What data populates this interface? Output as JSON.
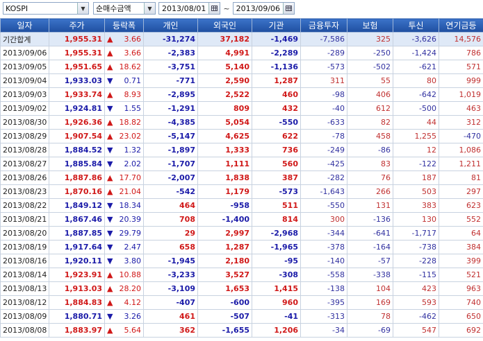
{
  "toolbar": {
    "market": "KOSPI",
    "metric": "순매수금액",
    "start_date": "2013/08/01",
    "separator": "~",
    "end_date": "2013/09/06"
  },
  "columns": [
    "일자",
    "주가",
    "등락폭",
    "개인",
    "외국인",
    "기관",
    "금융투자",
    "보험",
    "투신",
    "연기금등"
  ],
  "summary": {
    "date": "기간합계",
    "price": "1,955.31",
    "dir": "up",
    "change": "3.66",
    "individual": "-31,274",
    "foreign": "37,182",
    "institution": "-1,469",
    "fin_invest": "-7,586",
    "insurance": "325",
    "trust": "-3,626",
    "pension": "14,576"
  },
  "rows": [
    {
      "date": "2013/09/06",
      "price": "1,955.31",
      "dir": "up",
      "change": "3.66",
      "individual": "-2,383",
      "foreign": "4,991",
      "institution": "-2,289",
      "fin_invest": "-289",
      "insurance": "-250",
      "trust": "-1,424",
      "pension": "786"
    },
    {
      "date": "2013/09/05",
      "price": "1,951.65",
      "dir": "up",
      "change": "18.62",
      "individual": "-3,751",
      "foreign": "5,140",
      "institution": "-1,136",
      "fin_invest": "-573",
      "insurance": "-502",
      "trust": "-621",
      "pension": "571"
    },
    {
      "date": "2013/09/04",
      "price": "1,933.03",
      "dir": "down",
      "change": "0.71",
      "individual": "-771",
      "foreign": "2,590",
      "institution": "1,287",
      "fin_invest": "311",
      "insurance": "55",
      "trust": "80",
      "pension": "999"
    },
    {
      "date": "2013/09/03",
      "price": "1,933.74",
      "dir": "up",
      "change": "8.93",
      "individual": "-2,895",
      "foreign": "2,522",
      "institution": "460",
      "fin_invest": "-98",
      "insurance": "406",
      "trust": "-642",
      "pension": "1,019"
    },
    {
      "date": "2013/09/02",
      "price": "1,924.81",
      "dir": "down",
      "change": "1.55",
      "individual": "-1,291",
      "foreign": "809",
      "institution": "432",
      "fin_invest": "-40",
      "insurance": "612",
      "trust": "-500",
      "pension": "463"
    },
    {
      "date": "2013/08/30",
      "price": "1,926.36",
      "dir": "up",
      "change": "18.82",
      "individual": "-4,385",
      "foreign": "5,054",
      "institution": "-550",
      "fin_invest": "-633",
      "insurance": "82",
      "trust": "44",
      "pension": "312"
    },
    {
      "date": "2013/08/29",
      "price": "1,907.54",
      "dir": "up",
      "change": "23.02",
      "individual": "-5,147",
      "foreign": "4,625",
      "institution": "622",
      "fin_invest": "-78",
      "insurance": "458",
      "trust": "1,255",
      "pension": "-470"
    },
    {
      "date": "2013/08/28",
      "price": "1,884.52",
      "dir": "down",
      "change": "1.32",
      "individual": "-1,897",
      "foreign": "1,333",
      "institution": "736",
      "fin_invest": "-249",
      "insurance": "-86",
      "trust": "12",
      "pension": "1,086"
    },
    {
      "date": "2013/08/27",
      "price": "1,885.84",
      "dir": "down",
      "change": "2.02",
      "individual": "-1,707",
      "foreign": "1,111",
      "institution": "560",
      "fin_invest": "-425",
      "insurance": "83",
      "trust": "-122",
      "pension": "1,211"
    },
    {
      "date": "2013/08/26",
      "price": "1,887.86",
      "dir": "up",
      "change": "17.70",
      "individual": "-2,007",
      "foreign": "1,838",
      "institution": "387",
      "fin_invest": "-282",
      "insurance": "76",
      "trust": "187",
      "pension": "81"
    },
    {
      "date": "2013/08/23",
      "price": "1,870.16",
      "dir": "up",
      "change": "21.04",
      "individual": "-542",
      "foreign": "1,179",
      "institution": "-573",
      "fin_invest": "-1,643",
      "insurance": "266",
      "trust": "503",
      "pension": "297"
    },
    {
      "date": "2013/08/22",
      "price": "1,849.12",
      "dir": "down",
      "change": "18.34",
      "individual": "464",
      "foreign": "-958",
      "institution": "511",
      "fin_invest": "-550",
      "insurance": "131",
      "trust": "383",
      "pension": "623"
    },
    {
      "date": "2013/08/21",
      "price": "1,867.46",
      "dir": "down",
      "change": "20.39",
      "individual": "708",
      "foreign": "-1,400",
      "institution": "814",
      "fin_invest": "300",
      "insurance": "-136",
      "trust": "130",
      "pension": "552"
    },
    {
      "date": "2013/08/20",
      "price": "1,887.85",
      "dir": "down",
      "change": "29.79",
      "individual": "29",
      "foreign": "2,997",
      "institution": "-2,968",
      "fin_invest": "-344",
      "insurance": "-641",
      "trust": "-1,717",
      "pension": "64"
    },
    {
      "date": "2013/08/19",
      "price": "1,917.64",
      "dir": "down",
      "change": "2.47",
      "individual": "658",
      "foreign": "1,287",
      "institution": "-1,965",
      "fin_invest": "-378",
      "insurance": "-164",
      "trust": "-738",
      "pension": "384"
    },
    {
      "date": "2013/08/16",
      "price": "1,920.11",
      "dir": "down",
      "change": "3.80",
      "individual": "-1,945",
      "foreign": "2,180",
      "institution": "-95",
      "fin_invest": "-140",
      "insurance": "-57",
      "trust": "-228",
      "pension": "399"
    },
    {
      "date": "2013/08/14",
      "price": "1,923.91",
      "dir": "up",
      "change": "10.88",
      "individual": "-3,233",
      "foreign": "3,527",
      "institution": "-308",
      "fin_invest": "-558",
      "insurance": "-338",
      "trust": "-115",
      "pension": "521"
    },
    {
      "date": "2013/08/13",
      "price": "1,913.03",
      "dir": "up",
      "change": "28.20",
      "individual": "-3,109",
      "foreign": "1,653",
      "institution": "1,415",
      "fin_invest": "-138",
      "insurance": "104",
      "trust": "423",
      "pension": "963"
    },
    {
      "date": "2013/08/12",
      "price": "1,884.83",
      "dir": "up",
      "change": "4.12",
      "individual": "-407",
      "foreign": "-600",
      "institution": "960",
      "fin_invest": "-395",
      "insurance": "169",
      "trust": "593",
      "pension": "740"
    },
    {
      "date": "2013/08/09",
      "price": "1,880.71",
      "dir": "down",
      "change": "3.26",
      "individual": "461",
      "foreign": "-507",
      "institution": "-41",
      "fin_invest": "-313",
      "insurance": "78",
      "trust": "-462",
      "pension": "650"
    },
    {
      "date": "2013/08/08",
      "price": "1,883.97",
      "dir": "up",
      "change": "5.64",
      "individual": "362",
      "foreign": "-1,655",
      "institution": "1,206",
      "fin_invest": "-34",
      "insurance": "-69",
      "trust": "547",
      "pension": "692"
    }
  ],
  "colors": {
    "up": "#d01818",
    "down": "#1a1aa8",
    "header": "#2a5cb0",
    "summary_bg": "#dfe9f7"
  },
  "icons": {
    "dropdown": "chevron-down-icon",
    "calendar": "calendar-icon",
    "up": "triangle-up-icon",
    "down": "triangle-down-icon"
  }
}
